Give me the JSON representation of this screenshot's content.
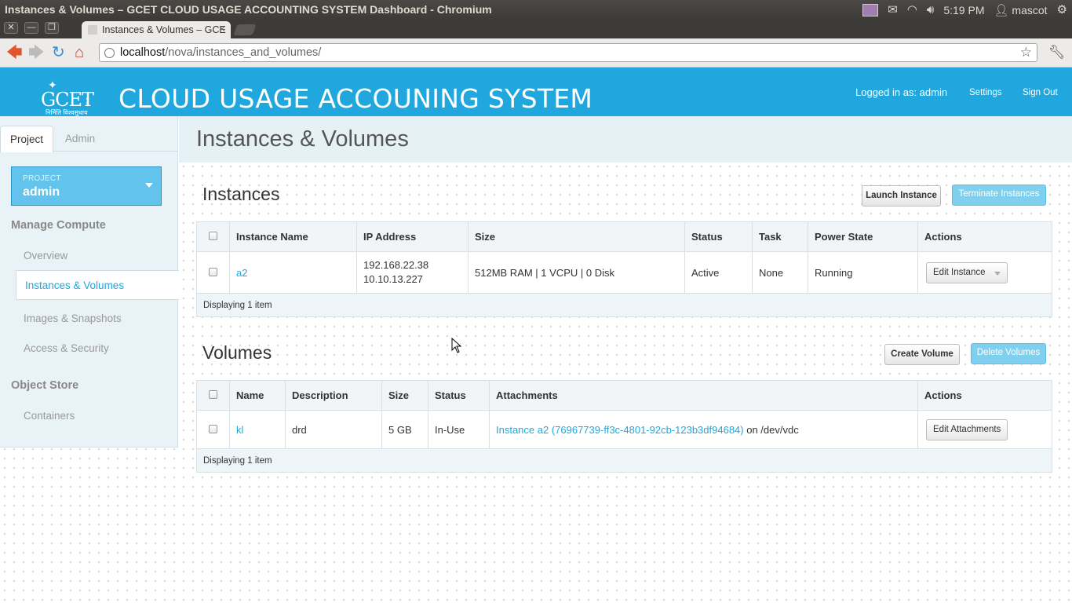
{
  "os": {
    "window_title": "Instances & Volumes – GCET CLOUD USAGE ACCOUNTING SYSTEM Dashboard - Chromium",
    "clock": "5:19 PM",
    "user": "mascot",
    "tray_icons": [
      "indicator-icon",
      "mail-icon",
      "wifi-icon",
      "volume-icon",
      "user-icon",
      "settings-gear-icon"
    ]
  },
  "browser": {
    "tab_title": "Instances & Volumes – GCE",
    "url_host": "localhost",
    "url_path": "/nova/instances_and_volumes/"
  },
  "header": {
    "logo_text": "GCET",
    "logo_sub": "निर्मिति विश्वसुधाय",
    "site_title": "CLOUD USAGE ACCOUNING SYSTEM",
    "logged_in": "Logged in as: admin",
    "settings": "Settings",
    "sign_out": "Sign Out",
    "color": "#1fa7de"
  },
  "sidebar": {
    "tabs": [
      "Project",
      "Admin"
    ],
    "project_label": "PROJECT",
    "project_name": "admin",
    "sections": [
      {
        "heading": "Manage Compute",
        "items": [
          "Overview",
          "Instances & Volumes",
          "Images & Snapshots",
          "Access & Security"
        ]
      },
      {
        "heading": "Object Store",
        "items": [
          "Containers"
        ]
      }
    ]
  },
  "main": {
    "page_title": "Instances & Volumes",
    "instances": {
      "title": "Instances",
      "launch_button": "Launch Instance",
      "terminate_button": "Terminate Instances",
      "columns": [
        "Instance Name",
        "IP Address",
        "Size",
        "Status",
        "Task",
        "Power State",
        "Actions"
      ],
      "rows": [
        {
          "name": "a2",
          "ip1": "192.168.22.38",
          "ip2": "10.10.13.227",
          "size": "512MB RAM | 1 VCPU | 0 Disk",
          "status": "Active",
          "task": "None",
          "power": "Running",
          "action": "Edit Instance"
        }
      ],
      "footer": "Displaying 1 item"
    },
    "volumes": {
      "title": "Volumes",
      "create_button": "Create Volume",
      "delete_button": "Delete Volumes",
      "columns": [
        "Name",
        "Description",
        "Size",
        "Status",
        "Attachments",
        "Actions"
      ],
      "rows": [
        {
          "name": "kl",
          "description": "drd",
          "size": "5 GB",
          "status": "In-Use",
          "attachment_link": "Instance a2 (76967739-ff3c-4801-92cb-123b3df94684)",
          "attachment_suffix": " on /dev/vdc",
          "action": "Edit Attachments"
        }
      ],
      "footer": "Displaying 1 item"
    }
  }
}
